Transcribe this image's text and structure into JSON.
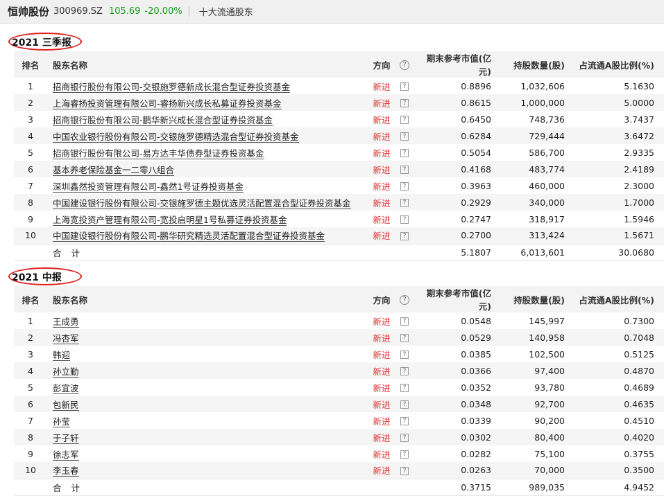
{
  "header": {
    "stock_name": "恒帅股份",
    "stock_code": "300969.SZ",
    "price": "105.69",
    "change": "-20.00%",
    "tab": "十大流通股东"
  },
  "columns": {
    "rank": "排名",
    "name": "股东名称",
    "direction": "方向",
    "help": "?",
    "value": "期末参考市值(亿元)",
    "holdings": "持股数量(股)",
    "ratio": "占流通A股比例(%)"
  },
  "q_glyph": "?",
  "sections": [
    {
      "title": "2021 三季报",
      "rows": [
        {
          "rank": "1",
          "name": "招商银行股份有限公司-交银施罗德新成长混合型证券投资基金",
          "direction": "新进",
          "value": "0.8896",
          "holdings": "1,032,606",
          "ratio": "5.1630"
        },
        {
          "rank": "2",
          "name": "上海睿扬投资管理有限公司-睿扬新兴成长私募证券投资基金",
          "direction": "新进",
          "value": "0.8615",
          "holdings": "1,000,000",
          "ratio": "5.0000"
        },
        {
          "rank": "3",
          "name": "招商银行股份有限公司-鹏华新兴成长混合型证券投资基金",
          "direction": "新进",
          "value": "0.6450",
          "holdings": "748,736",
          "ratio": "3.7437"
        },
        {
          "rank": "4",
          "name": "中国农业银行股份有限公司-交银施罗德精选混合型证券投资基金",
          "direction": "新进",
          "value": "0.6284",
          "holdings": "729,444",
          "ratio": "3.6472"
        },
        {
          "rank": "5",
          "name": "招商银行股份有限公司-易方达丰华债券型证券投资基金",
          "direction": "新进",
          "value": "0.5054",
          "holdings": "586,700",
          "ratio": "2.9335"
        },
        {
          "rank": "6",
          "name": "基本养老保险基金一二零八组合",
          "direction": "新进",
          "value": "0.4168",
          "holdings": "483,774",
          "ratio": "2.4189"
        },
        {
          "rank": "7",
          "name": "深圳鑫然投资管理有限公司-鑫然1号证券投资基金",
          "direction": "新进",
          "value": "0.3963",
          "holdings": "460,000",
          "ratio": "2.3000"
        },
        {
          "rank": "8",
          "name": "中国建设银行股份有限公司-交银施罗德主题优选灵活配置混合型证券投资基金",
          "direction": "新进",
          "value": "0.2929",
          "holdings": "340,000",
          "ratio": "1.7000"
        },
        {
          "rank": "9",
          "name": "上海宽投资产管理有限公司-宽投启明星1号私募证券投资基金",
          "direction": "新进",
          "value": "0.2747",
          "holdings": "318,917",
          "ratio": "1.5946"
        },
        {
          "rank": "10",
          "name": "中国建设银行股份有限公司-鹏华研究精选灵活配置混合型证券投资基金",
          "direction": "新进",
          "value": "0.2700",
          "holdings": "313,424",
          "ratio": "1.5671"
        }
      ],
      "total": {
        "label": "合计",
        "value": "5.1807",
        "holdings": "6,013,601",
        "ratio": "30.0680"
      }
    },
    {
      "title": "2021 中报",
      "rows": [
        {
          "rank": "1",
          "name": "王成勇",
          "direction": "新进",
          "value": "0.0548",
          "holdings": "145,997",
          "ratio": "0.7300"
        },
        {
          "rank": "2",
          "name": "冯杏军",
          "direction": "新进",
          "value": "0.0529",
          "holdings": "140,958",
          "ratio": "0.7048"
        },
        {
          "rank": "3",
          "name": "韩迎",
          "direction": "新进",
          "value": "0.0385",
          "holdings": "102,500",
          "ratio": "0.5125"
        },
        {
          "rank": "4",
          "name": "孙立勤",
          "direction": "新进",
          "value": "0.0366",
          "holdings": "97,400",
          "ratio": "0.4870"
        },
        {
          "rank": "5",
          "name": "彭宜波",
          "direction": "新进",
          "value": "0.0352",
          "holdings": "93,780",
          "ratio": "0.4689"
        },
        {
          "rank": "6",
          "name": "包新民",
          "direction": "新进",
          "value": "0.0348",
          "holdings": "92,700",
          "ratio": "0.4635"
        },
        {
          "rank": "7",
          "name": "孙莹",
          "direction": "新进",
          "value": "0.0339",
          "holdings": "90,200",
          "ratio": "0.4510"
        },
        {
          "rank": "8",
          "name": "于子轩",
          "direction": "新进",
          "value": "0.0302",
          "holdings": "80,400",
          "ratio": "0.4020"
        },
        {
          "rank": "9",
          "name": "徐志军",
          "direction": "新进",
          "value": "0.0282",
          "holdings": "75,100",
          "ratio": "0.3755"
        },
        {
          "rank": "10",
          "name": "李玉春",
          "direction": "新进",
          "value": "0.0263",
          "holdings": "70,000",
          "ratio": "0.3500"
        }
      ],
      "total": {
        "label": "合计",
        "value": "0.3715",
        "holdings": "989,035",
        "ratio": "4.9452"
      }
    }
  ],
  "colors": {
    "accent_red": "#e03030",
    "price_green": "#119911",
    "highlight_ring": "#e02020"
  }
}
